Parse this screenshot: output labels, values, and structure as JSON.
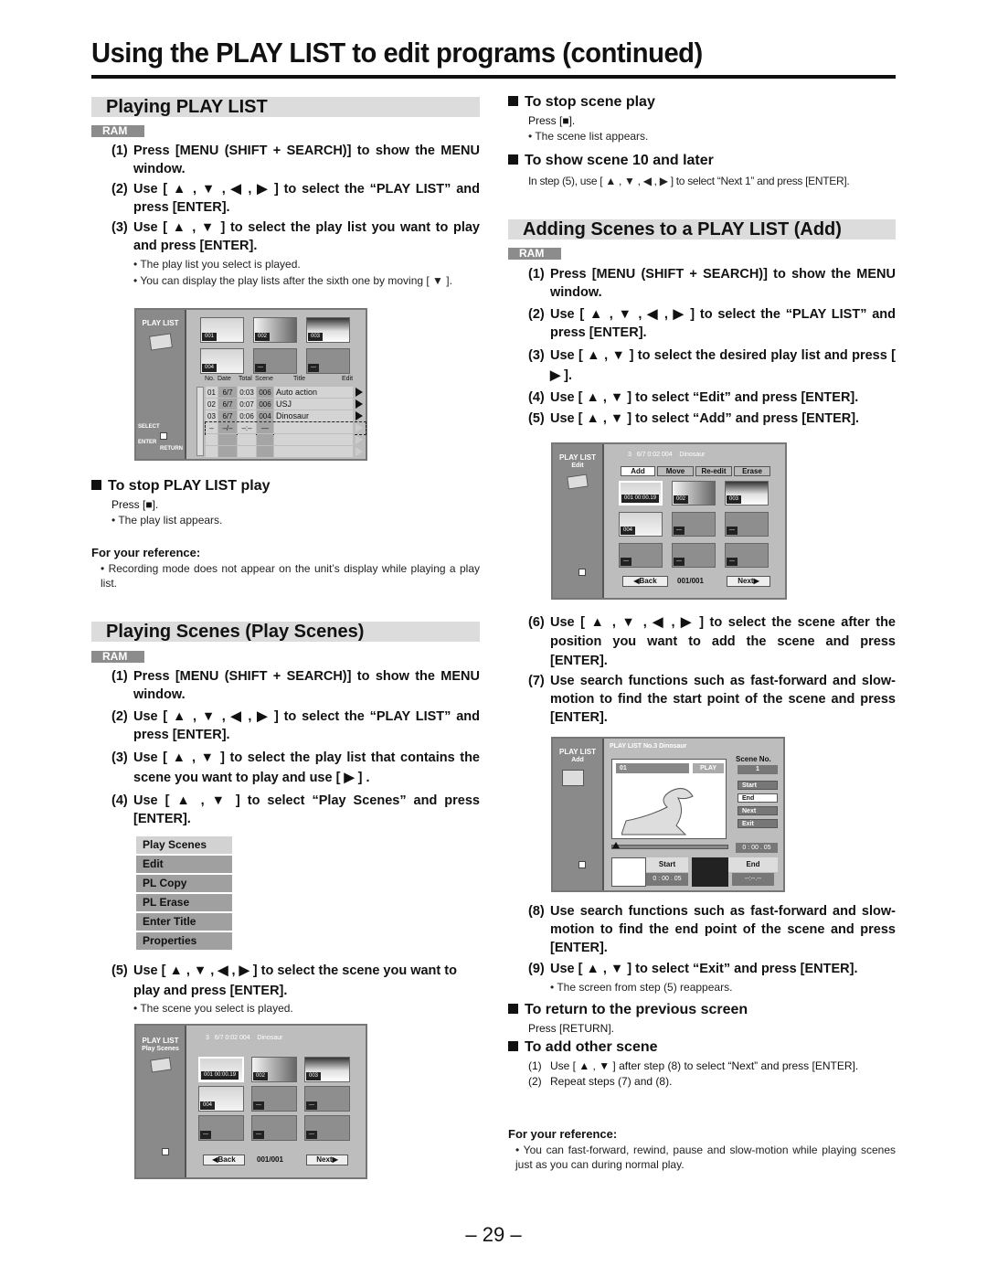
{
  "page": {
    "title": "Using the PLAY LIST to edit programs (continued)",
    "page_number": "– 29 –"
  },
  "arrows": {
    "up": "▲",
    "down": "▼",
    "left": "◀",
    "right": "▶",
    "stop": "■"
  },
  "playing_play_list": {
    "heading": "Playing PLAY LIST",
    "badge": "RAM",
    "steps": [
      {
        "num": "(1)",
        "text": "Press [MENU (SHIFT + SEARCH)] to show the MENU window."
      },
      {
        "num": "(2)",
        "text": "Use [ ▲ , ▼ , ◀ , ▶ ] to select the “PLAY LIST” and press [ENTER]."
      },
      {
        "num": "(3)",
        "text": "Use [ ▲ , ▼ ] to select the play list you want to play and press [ENTER]."
      }
    ],
    "notes": [
      "• The play list you select is played.",
      "• You can display the play lists after the sixth one by moving [ ▼ ]."
    ],
    "screen": {
      "side_label": "PLAY LIST",
      "thumbs": [
        "001",
        "002",
        "003",
        "004",
        "---",
        "---"
      ],
      "columns": [
        "No.",
        "Date",
        "Total",
        "Scene",
        "Title",
        "Edit"
      ],
      "rows": [
        {
          "no": "01",
          "date": "6/7",
          "total": "0:03",
          "scene": "006",
          "title": "Auto action"
        },
        {
          "no": "02",
          "date": "6/7",
          "total": "0:07",
          "scene": "006",
          "title": "USJ"
        },
        {
          "no": "03",
          "date": "6/7",
          "total": "0:06",
          "scene": "004",
          "title": "Dinosaur"
        },
        {
          "no": "–",
          "date": "–/–",
          "total": "–:–",
          "scene": "—",
          "title": ""
        }
      ],
      "select_label": "SELECT",
      "enter_label": "ENTER",
      "return_label": "RETURN"
    },
    "stop": {
      "heading": "To stop PLAY LIST play",
      "press": "Press [■].",
      "note": "• The play list appears."
    },
    "reference": {
      "heading": "For your reference:",
      "note": "• Recording mode does not appear on the unit’s display while playing a play list."
    }
  },
  "playing_scenes": {
    "heading": "Playing Scenes (Play Scenes)",
    "badge": "RAM",
    "steps": [
      {
        "num": "(1)",
        "text": "Press [MENU (SHIFT + SEARCH)] to show the MENU window."
      },
      {
        "num": "(2)",
        "text": "Use [ ▲ , ▼ , ◀ , ▶ ] to select the “PLAY LIST” and press [ENTER]."
      },
      {
        "num": "(3)",
        "text": "Use [ ▲ , ▼ ] to select the play list that contains the scene you want to play and use [ ▶ ] ."
      },
      {
        "num": "(4)",
        "text": "Use [ ▲ , ▼ ] to select “Play Scenes” and press [ENTER]."
      },
      {
        "num": "(5)",
        "text": "Use [ ▲ , ▼ , ◀ , ▶ ] to select the scene you want to play and press [ENTER]."
      }
    ],
    "menu": [
      "Play Scenes",
      "Edit",
      "PL Copy",
      "PL Erase",
      "Enter Title",
      "Properties"
    ],
    "note5": "• The scene you select is played.",
    "screen": {
      "side_label_1": "PLAY LIST",
      "side_label_2": "Play Scenes",
      "header": "3   6/7 0:02 004    Dinosaur",
      "thumbs": [
        "001 00:00.19",
        "002",
        "003",
        "004",
        "---",
        "---",
        "---",
        "---",
        "---"
      ],
      "back": "◀Back",
      "page": "001/001",
      "next": "Next▶"
    }
  },
  "right": {
    "stop_scene": {
      "heading": "To stop scene play",
      "press": "Press [■].",
      "note": "• The scene list appears."
    },
    "show_scene10": {
      "heading": "To show scene 10 and later",
      "text": "In step (5), use [ ▲ , ▼ , ◀ , ▶ ] to select “Next 1” and press [ENTER]."
    }
  },
  "adding_scenes": {
    "heading": "Adding Scenes to a PLAY LIST (Add)",
    "badge": "RAM",
    "steps_a": [
      {
        "num": "(1)",
        "text": "Press [MENU (SHIFT + SEARCH)] to show the MENU window."
      },
      {
        "num": "(2)",
        "text": "Use [ ▲ , ▼ , ◀ , ▶ ] to select the “PLAY LIST” and press [ENTER]."
      },
      {
        "num": "(3)",
        "text": "Use [ ▲ , ▼ ] to select the desired play list and press [ ▶ ]."
      },
      {
        "num": "(4)",
        "text": "Use [ ▲ , ▼ ] to select “Edit” and press [ENTER]."
      },
      {
        "num": "(5)",
        "text": "Use [ ▲ , ▼ ] to select “Add” and press [ENTER]."
      }
    ],
    "edit_screen": {
      "side_label_1": "PLAY LIST",
      "side_label_2": "Edit",
      "header": "3   6/7 0:02 004    Dinosaur",
      "tabs": [
        "Add",
        "Move",
        "Re-edit",
        "Erase"
      ],
      "thumbs": [
        "001 00:00.19",
        "002",
        "003",
        "004",
        "---",
        "---",
        "---",
        "---",
        "---"
      ],
      "back": "◀Back",
      "page": "001/001",
      "next": "Next▶"
    },
    "steps_b": [
      {
        "num": "(6)",
        "text": "Use [ ▲ , ▼ , ◀ , ▶ ] to select the scene after the position you want to add the scene and press [ENTER]."
      },
      {
        "num": "(7)",
        "text": "Use search functions such as fast-forward and slow-motion to find the start point of the scene and press [ENTER]."
      }
    ],
    "add_screen": {
      "side_label_1": "PLAY LIST",
      "side_label_2": "Add",
      "header": "PLAY LIST No.3 Dinosaur",
      "scene_no_label": "Scene No.",
      "scene_no": "1",
      "video_index": "01",
      "video_status": "PLAY",
      "buttons": [
        "Start",
        "End",
        "Next",
        "Exit"
      ],
      "current_time": "0 : 00 . 05",
      "start_label": "Start",
      "start_time": "0 : 00 . 05",
      "end_label": "End",
      "end_time": "--:--.--",
      "seek_progress": 0.03
    },
    "steps_c": [
      {
        "num": "(8)",
        "text": "Use search functions such as fast-forward and slow-motion to find the end point of the scene and press [ENTER]."
      },
      {
        "num": "(9)",
        "text": "Use [ ▲ , ▼ ] to select “Exit” and press [ENTER]."
      }
    ],
    "note9": "• The screen from step (5) reappears.",
    "return_prev": {
      "heading": "To return to the previous screen",
      "text": "Press [RETURN]."
    },
    "add_other": {
      "heading": "To add other scene",
      "items": [
        {
          "num": "(1)",
          "text": "Use [ ▲ , ▼ ] after step (8) to select “Next” and press [ENTER]."
        },
        {
          "num": "(2)",
          "text": "Repeat steps (7) and (8)."
        }
      ]
    },
    "reference": {
      "heading": "For your reference:",
      "note": "• You can fast-forward, rewind, pause and slow-motion while playing scenes just as you can during normal play."
    }
  }
}
